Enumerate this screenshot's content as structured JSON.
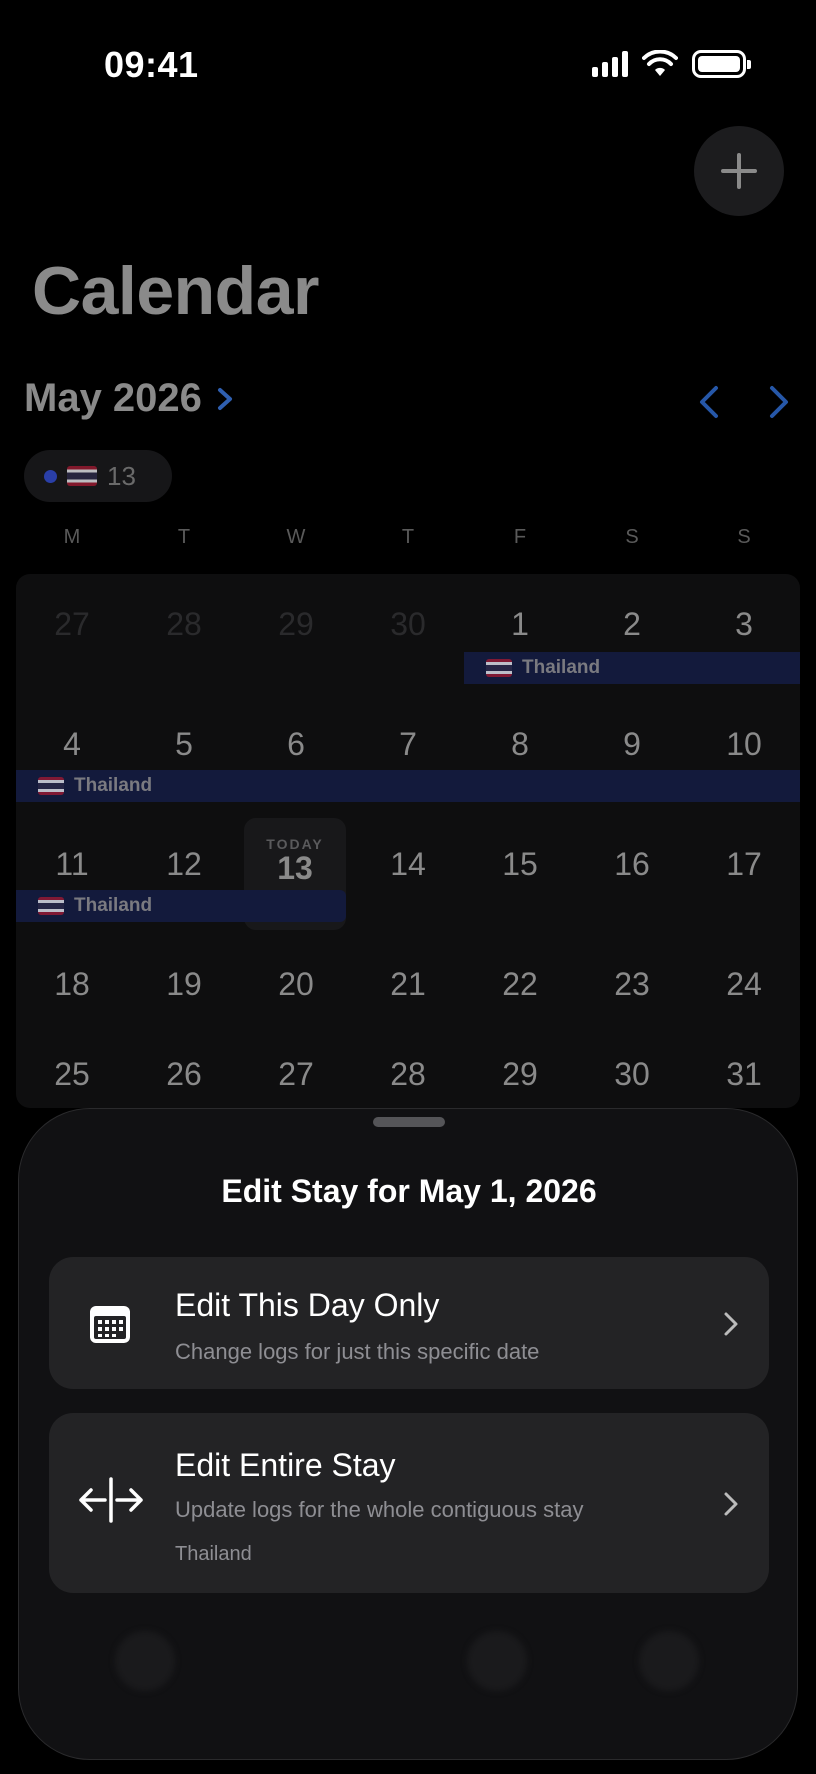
{
  "status_bar": {
    "time": "09:41"
  },
  "header": {
    "title": "Calendar",
    "add_icon": "plus-icon"
  },
  "month_nav": {
    "label": "May 2026"
  },
  "country_pill": {
    "count": "13"
  },
  "weekdays": [
    "M",
    "T",
    "W",
    "T",
    "F",
    "S",
    "S"
  ],
  "calendar": {
    "weeks": [
      [
        "27",
        "28",
        "29",
        "30",
        "1",
        "2",
        "3"
      ],
      [
        "4",
        "5",
        "6",
        "7",
        "8",
        "9",
        "10"
      ],
      [
        "11",
        "12",
        "13",
        "14",
        "15",
        "16",
        "17"
      ],
      [
        "18",
        "19",
        "20",
        "21",
        "22",
        "23",
        "24"
      ],
      [
        "25",
        "26",
        "27",
        "28",
        "29",
        "30",
        "31"
      ]
    ],
    "stay_label": "Thailand",
    "today_tag": "TODAY",
    "today_day": "13"
  },
  "sheet": {
    "title": "Edit Stay for May 1, 2026",
    "option_day": {
      "title": "Edit This Day Only",
      "subtitle": "Change logs for just this specific date",
      "icon": "calendar-icon"
    },
    "option_stay": {
      "title": "Edit Entire Stay",
      "subtitle": "Update logs for the whole contiguous stay",
      "extra": "Thailand",
      "icon": "arrows-split-icon"
    }
  },
  "colors": {
    "accent_blue": "#2f6fde",
    "stay_bar": "#131a3c",
    "sheet_bg": "#111113",
    "card_bg": "#232325"
  }
}
